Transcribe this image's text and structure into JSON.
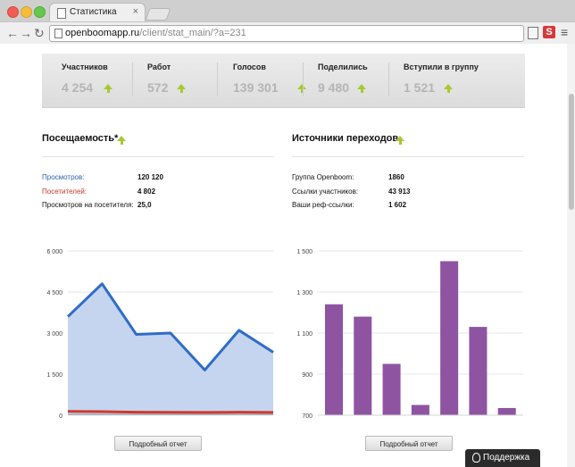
{
  "browser": {
    "tab_title": "Статистика",
    "tab_close": "×",
    "url_host": "openboomapp.ru",
    "url_path": "/client/stat_main/?a=231",
    "ext_label": "S"
  },
  "stats": [
    {
      "label": "Участников",
      "value": "4 254"
    },
    {
      "label": "Работ",
      "value": "572"
    },
    {
      "label": "Голосов",
      "value": "139 301"
    },
    {
      "label": "Поделились",
      "value": "9 480"
    },
    {
      "label": "Вступили в группу",
      "value": "1 521"
    }
  ],
  "attendance": {
    "title": "Посещаемость*",
    "rows": [
      {
        "label": "Просмотров:",
        "value": "120 120"
      },
      {
        "label": "Посетителей:",
        "value": "4 802"
      },
      {
        "label": "Просмотров на посетителя:",
        "value": "25,0"
      }
    ],
    "button": "Подробный отчет"
  },
  "sources": {
    "title": "Источники переходов",
    "rows": [
      {
        "label": "Группа Openboom:",
        "value": "1860"
      },
      {
        "label": "Ссылки участников:",
        "value": "43 913"
      },
      {
        "label": "Ваши реф-ссылки:",
        "value": "1 602"
      }
    ],
    "button": "Подробный отчет"
  },
  "support_label": "Поддержка",
  "colors": {
    "views": "#2f6cc7",
    "views_fill": "#c5d4ef",
    "visitors": "#d0392b",
    "bars": "#8e54a2",
    "arrow": "#a8c832"
  },
  "chart_data": [
    {
      "type": "area",
      "ylim": [
        0,
        6000
      ],
      "yticks": [
        "6 000",
        "4 500",
        "3 000",
        "1 500",
        "0"
      ],
      "yticks_values": [
        6000,
        4500,
        3000,
        1500,
        0
      ],
      "series": [
        {
          "values": [
            3600,
            4800,
            2950,
            3000,
            1650,
            3100,
            2300
          ]
        },
        {
          "values": [
            140,
            130,
            110,
            105,
            100,
            110,
            100
          ]
        },
        {
          "values": [
            30,
            30,
            30,
            30,
            30,
            30,
            30
          ]
        }
      ]
    },
    {
      "type": "bar",
      "ylim": [
        700,
        1500
      ],
      "yticks": [
        "1 500",
        "1 300",
        "1 100",
        "900",
        "700"
      ],
      "yticks_values": [
        1500,
        1300,
        1100,
        900,
        700
      ],
      "values": [
        1240,
        1180,
        950,
        750,
        1450,
        1130,
        735
      ]
    }
  ]
}
